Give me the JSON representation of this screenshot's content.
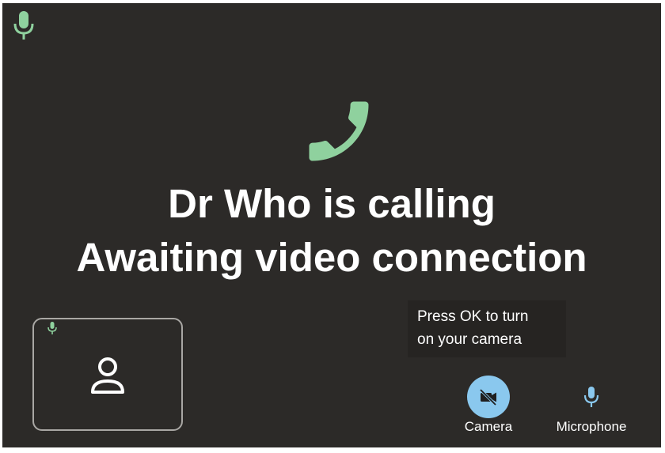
{
  "call": {
    "line1": "Dr Who is calling",
    "line2": "Awaiting video connection"
  },
  "hint": {
    "line1": "Press OK to turn",
    "line2": "on your camera"
  },
  "controls": {
    "camera_label": "Camera",
    "microphone_label": "Microphone"
  },
  "icons": {
    "status_mic": "microphone-icon",
    "call": "phone-icon",
    "self_mic": "microphone-icon",
    "avatar": "person-icon",
    "camera": "camera-off-icon",
    "microphone": "microphone-icon"
  },
  "colors": {
    "background": "#2c2a28",
    "accent_green": "#8fd19e",
    "camera_button": "#8ac8ee",
    "mic_blue": "#8ac8ee",
    "text": "#ffffff"
  }
}
